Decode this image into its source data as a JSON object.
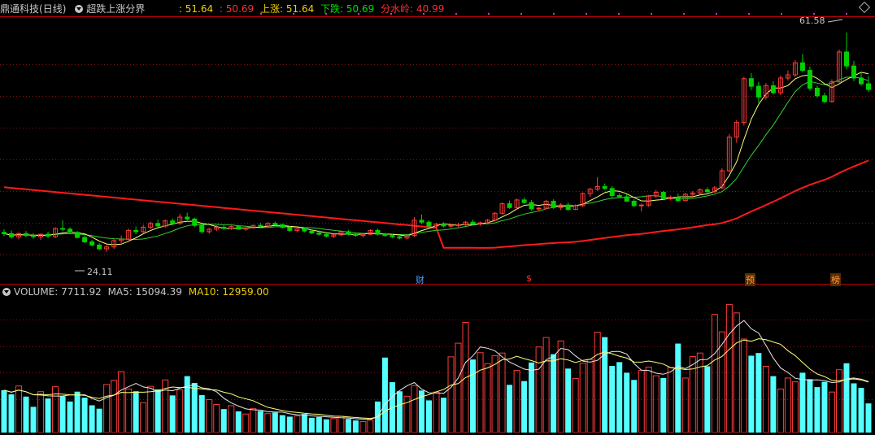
{
  "header": {
    "stock_name": "鼎通科技",
    "period": "(日线)",
    "indicator_name": "超跌上涨分界",
    "value1": ": 51.64",
    "value2": ": 50.69",
    "up_label": "上涨",
    "up_value": ": 51.64",
    "down_label": "下跌",
    "down_value": ": 50.69",
    "watershed_label": "分水岭",
    "watershed_value": ": 40.99"
  },
  "price_pane": {
    "high_label": "61.58",
    "low_label": "24.11",
    "markers": [
      {
        "label": "财",
        "color": "#4aa0ff"
      },
      {
        "label": "$",
        "color": "#ff3030"
      },
      {
        "label": "预",
        "color": "#ff9a3c"
      },
      {
        "label": "榜",
        "color": "#ff9a3c"
      }
    ]
  },
  "volume_pane": {
    "name": "VOLUME",
    "volume_value": ": 7711.92",
    "ma5_label": "MA5",
    "ma5_value": ": 15094.39",
    "ma10_label": "MA10",
    "ma10_value": ": 12959.00"
  },
  "colors": {
    "up": "#ff3c3c",
    "down": "#54ffff",
    "down_candle": "#00d200",
    "ma_red": "#ff1a1a",
    "ma_yellow": "#ffff78",
    "ma_green": "#34d034",
    "grid": "#8a1010",
    "border": "#c00000",
    "label_gold": "#f0d000",
    "label_green": "#00e000",
    "label_red": "#ff3030"
  },
  "chart_data": {
    "type": "candlestick",
    "candles": [
      [
        30.1,
        30.6,
        29.5,
        29.9
      ],
      [
        29.9,
        30.4,
        29.1,
        29.4
      ],
      [
        29.4,
        30.1,
        29.0,
        29.9
      ],
      [
        29.9,
        30.3,
        29.3,
        29.6
      ],
      [
        29.6,
        30.0,
        29.1,
        29.4
      ],
      [
        29.4,
        29.9,
        28.9,
        29.8
      ],
      [
        29.8,
        30.2,
        29.2,
        29.5
      ],
      [
        29.4,
        30.9,
        29.2,
        30.7
      ],
      [
        30.7,
        32.0,
        30.3,
        30.6
      ],
      [
        30.6,
        30.9,
        29.9,
        30.1
      ],
      [
        30.1,
        30.3,
        29.1,
        29.3
      ],
      [
        29.3,
        29.6,
        28.4,
        28.6
      ],
      [
        28.6,
        28.9,
        27.9,
        28.1
      ],
      [
        28.1,
        28.4,
        27.3,
        27.5
      ],
      [
        27.5,
        28.1,
        27.0,
        27.8
      ],
      [
        27.8,
        29.1,
        27.5,
        28.8
      ],
      [
        28.8,
        29.6,
        28.4,
        29.0
      ],
      [
        29.0,
        30.7,
        28.8,
        30.4
      ],
      [
        30.4,
        31.0,
        29.8,
        30.2
      ],
      [
        30.2,
        31.3,
        29.9,
        30.9
      ],
      [
        30.9,
        31.8,
        30.6,
        31.5
      ],
      [
        31.5,
        32.1,
        30.9,
        31.1
      ],
      [
        31.1,
        32.1,
        30.8,
        31.9
      ],
      [
        31.9,
        32.3,
        31.2,
        31.5
      ],
      [
        31.5,
        33.0,
        31.3,
        32.5
      ],
      [
        32.5,
        33.2,
        31.8,
        32.2
      ],
      [
        32.2,
        32.4,
        30.9,
        31.2
      ],
      [
        31.2,
        31.4,
        29.9,
        30.2
      ],
      [
        30.2,
        30.8,
        29.9,
        30.6
      ],
      [
        30.6,
        31.2,
        30.3,
        30.9
      ],
      [
        30.9,
        31.3,
        30.5,
        30.7
      ],
      [
        30.7,
        31.2,
        30.5,
        31.0
      ],
      [
        31.0,
        31.2,
        30.5,
        30.6
      ],
      [
        30.6,
        30.9,
        30.3,
        30.8
      ],
      [
        30.8,
        31.3,
        30.7,
        31.2
      ],
      [
        31.2,
        31.6,
        30.9,
        31.1
      ],
      [
        31.1,
        31.7,
        31.0,
        31.5
      ],
      [
        31.5,
        31.8,
        31.2,
        31.3
      ],
      [
        31.3,
        31.5,
        30.7,
        30.9
      ],
      [
        30.9,
        31.1,
        30.2,
        30.4
      ],
      [
        30.4,
        30.8,
        30.1,
        30.7
      ],
      [
        30.7,
        30.9,
        30.1,
        30.3
      ],
      [
        30.3,
        30.5,
        29.8,
        30.0
      ],
      [
        30.0,
        30.4,
        29.6,
        29.8
      ],
      [
        29.8,
        30.1,
        29.3,
        29.5
      ],
      [
        29.5,
        29.9,
        29.2,
        29.7
      ],
      [
        29.7,
        30.4,
        29.5,
        30.2
      ],
      [
        30.2,
        30.5,
        29.6,
        29.8
      ],
      [
        29.8,
        30.1,
        29.4,
        29.6
      ],
      [
        29.6,
        30.0,
        29.3,
        29.8
      ],
      [
        29.8,
        30.6,
        29.7,
        30.4
      ],
      [
        30.4,
        30.7,
        29.6,
        29.8
      ],
      [
        29.8,
        30.0,
        29.4,
        29.6
      ],
      [
        29.6,
        29.9,
        29.2,
        29.4
      ],
      [
        29.4,
        29.7,
        29.0,
        29.2
      ],
      [
        29.2,
        29.8,
        29.0,
        29.6
      ],
      [
        29.6,
        32.5,
        29.4,
        32.0
      ],
      [
        32.0,
        32.9,
        31.4,
        31.7
      ],
      [
        31.7,
        32.0,
        30.9,
        31.1
      ],
      [
        31.1,
        31.6,
        30.8,
        31.4
      ],
      [
        31.4,
        31.7,
        30.9,
        31.1
      ],
      [
        31.1,
        31.5,
        30.8,
        31.2
      ],
      [
        31.2,
        31.6,
        30.9,
        31.3
      ],
      [
        31.3,
        31.9,
        31.1,
        31.7
      ],
      [
        31.7,
        32.1,
        31.2,
        31.4
      ],
      [
        31.4,
        31.8,
        31.1,
        31.6
      ],
      [
        31.6,
        32.2,
        31.4,
        32.0
      ],
      [
        32.0,
        33.3,
        31.8,
        33.1
      ],
      [
        33.1,
        34.8,
        32.9,
        34.6
      ],
      [
        34.6,
        35.1,
        33.8,
        34.0
      ],
      [
        34.0,
        35.4,
        33.7,
        35.2
      ],
      [
        35.2,
        35.6,
        34.6,
        34.8
      ],
      [
        34.8,
        35.2,
        33.5,
        33.8
      ],
      [
        33.8,
        34.1,
        33.4,
        33.9
      ],
      [
        33.9,
        35.2,
        33.8,
        35.0
      ],
      [
        35.0,
        35.3,
        33.8,
        34.0
      ],
      [
        34.0,
        34.7,
        33.6,
        34.4
      ],
      [
        34.4,
        34.8,
        33.5,
        33.7
      ],
      [
        33.7,
        34.5,
        33.6,
        34.3
      ],
      [
        34.3,
        36.4,
        34.1,
        36.2
      ],
      [
        36.2,
        37.1,
        35.7,
        36.9
      ],
      [
        36.9,
        38.8,
        36.6,
        37.3
      ],
      [
        37.3,
        37.8,
        36.8,
        37.0
      ],
      [
        37.0,
        37.4,
        35.5,
        35.9
      ],
      [
        35.9,
        36.3,
        35.6,
        35.7
      ],
      [
        35.7,
        36.1,
        34.9,
        35.0
      ],
      [
        35.0,
        35.3,
        34.1,
        34.3
      ],
      [
        34.3,
        34.6,
        33.4,
        34.4
      ],
      [
        34.4,
        36.0,
        34.1,
        35.8
      ],
      [
        35.8,
        36.8,
        35.5,
        36.4
      ],
      [
        36.4,
        36.6,
        35.2,
        35.4
      ],
      [
        35.4,
        35.9,
        35.1,
        35.6
      ],
      [
        35.6,
        36.2,
        34.9,
        35.1
      ],
      [
        35.1,
        36.3,
        35.0,
        36.1
      ],
      [
        36.1,
        36.6,
        35.7,
        36.3
      ],
      [
        36.3,
        37.0,
        36.0,
        36.8
      ],
      [
        36.8,
        37.2,
        36.3,
        36.5
      ],
      [
        36.5,
        37.4,
        36.3,
        37.1
      ],
      [
        37.1,
        40.2,
        36.9,
        39.8
      ],
      [
        39.8,
        45.6,
        39.5,
        45.1
      ],
      [
        45.1,
        47.8,
        44.2,
        47.4
      ],
      [
        47.4,
        54.6,
        46.9,
        54.3
      ],
      [
        54.3,
        55.2,
        52.5,
        53.1
      ],
      [
        53.1,
        53.8,
        50.5,
        51.4
      ],
      [
        51.4,
        53.6,
        51.0,
        53.2
      ],
      [
        53.2,
        53.9,
        51.8,
        52.1
      ],
      [
        52.1,
        54.8,
        51.7,
        54.4
      ],
      [
        54.4,
        55.6,
        54.0,
        54.9
      ],
      [
        54.9,
        57.2,
        54.6,
        56.8
      ],
      [
        56.8,
        58.2,
        55.3,
        55.6
      ],
      [
        55.6,
        56.2,
        52.4,
        52.8
      ],
      [
        52.8,
        53.2,
        51.3,
        51.6
      ],
      [
        51.6,
        52.1,
        50.4,
        50.7
      ],
      [
        50.7,
        54.2,
        50.5,
        53.8
      ],
      [
        53.8,
        58.9,
        53.5,
        58.5
      ],
      [
        58.5,
        61.58,
        55.8,
        56.3
      ],
      [
        56.3,
        57.1,
        53.9,
        54.4
      ],
      [
        54.4,
        55.4,
        53.2,
        53.5
      ],
      [
        53.5,
        54.7,
        52.2,
        52.6
      ]
    ],
    "volume": [
      11200,
      10100,
      12300,
      9500,
      6800,
      10800,
      9000,
      12100,
      9600,
      8200,
      10800,
      9200,
      7200,
      6300,
      12700,
      13800,
      16100,
      11500,
      10900,
      7900,
      12200,
      11400,
      13900,
      9800,
      11300,
      14900,
      13100,
      9900,
      8700,
      7400,
      6200,
      7100,
      5600,
      4900,
      6300,
      5700,
      5000,
      5300,
      4600,
      4200,
      4400,
      4900,
      3900,
      4100,
      3500,
      3700,
      4300,
      3600,
      3200,
      2900,
      3300,
      8200,
      19800,
      13300,
      10900,
      9600,
      12400,
      11100,
      8500,
      10700,
      9200,
      20000,
      23600,
      29100,
      19300,
      21100,
      18200,
      20300,
      21000,
      12600,
      16400,
      13600,
      18500,
      22600,
      25100,
      20700,
      24200,
      16900,
      14300,
      18300,
      19300,
      26500,
      25200,
      17600,
      18600,
      15800,
      13900,
      16400,
      17300,
      15000,
      14400,
      17200,
      23500,
      14400,
      20100,
      21000,
      17500,
      31200,
      26600,
      33800,
      31600,
      24700,
      20300,
      21000,
      17500,
      14900,
      11500,
      14400,
      13400,
      15800,
      14100,
      12000,
      13400,
      10700,
      16600,
      18300,
      13000,
      11800,
      7700
    ],
    "volume_ylim": [
      0,
      35000
    ],
    "price_ylim": [
      22,
      64
    ]
  }
}
